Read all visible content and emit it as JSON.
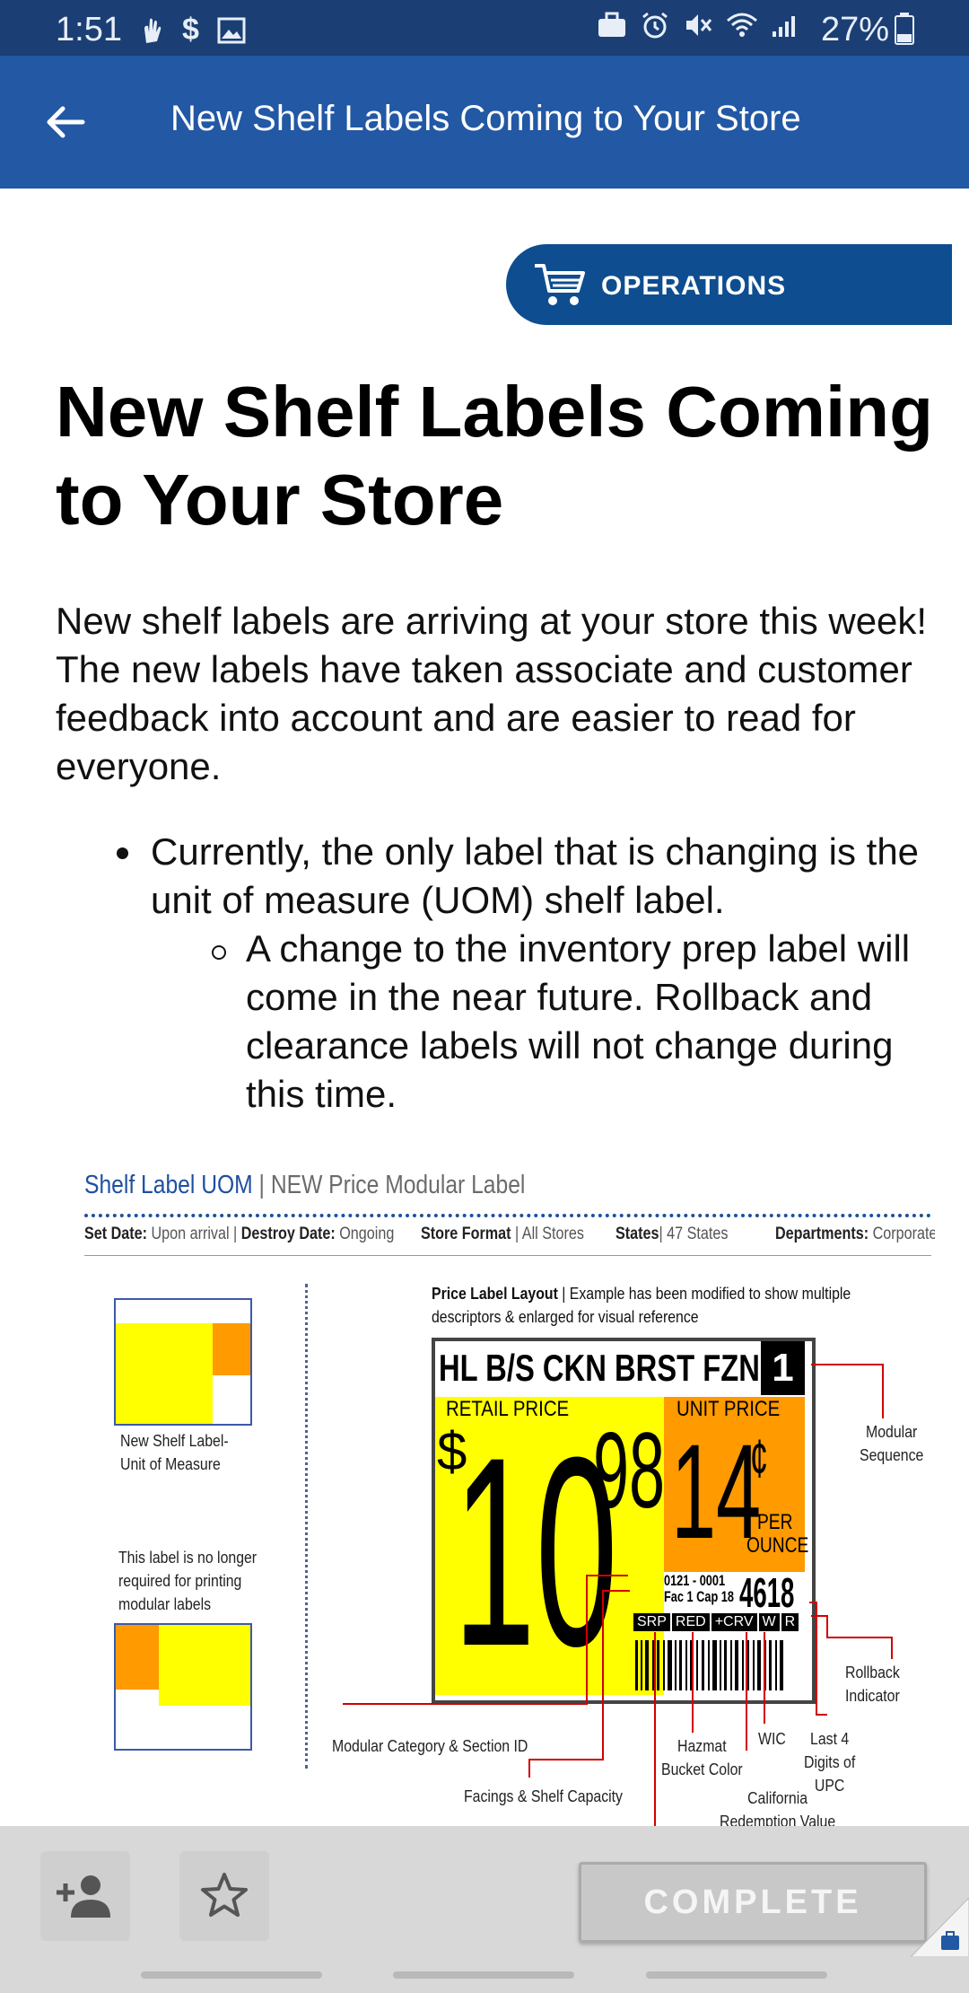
{
  "status_bar": {
    "time": "1:51",
    "battery": "27%"
  },
  "app_bar": {
    "title": "New Shelf Labels Coming to Your Store"
  },
  "badge": {
    "label": "OPERATIONS"
  },
  "article": {
    "title": "New Shelf Labels Coming to Your Store",
    "intro": "New shelf labels are arriving at your store this week! The new labels have taken associate and customer feedback into account and are easier to read for everyone.",
    "bullet1": "Currently, the only label that is changing is the unit of measure (UOM) shelf label.",
    "sub_bullet": "A change to the inventory prep label will come in the near future. Rollback and clearance labels will not change during this time."
  },
  "figure": {
    "heading": "Shelf Label UOM",
    "heading_sep": "|",
    "subheading": "NEW Price Modular Label",
    "meta": {
      "set_date_label": "Set Date:",
      "set_date": "Upon arrival",
      "destroy_date_label": "Destroy Date:",
      "destroy_date": "Ongoing",
      "store_format_label": "Store Format",
      "store_format": "All Stores",
      "states_label": "States",
      "states": "47 States",
      "departments_label": "Departments:",
      "departments": "Corporate"
    },
    "thumb1_caption_1": "New Shelf Label-",
    "thumb1_caption_2": "Unit of Measure",
    "thumb2_caption_1": "This label is no longer",
    "thumb2_caption_2": "required for printing",
    "thumb2_caption_3": "modular labels",
    "layout_title": "Price Label Layout",
    "layout_note_1": "Example has been modified to show multiple",
    "layout_note_2": "descriptors &  enlarged for visual reference",
    "label": {
      "description": "HL B/S CKN BRST FZN",
      "sequence": "1",
      "retail_price_label": "RETAIL PRICE",
      "dollar_sign": "$",
      "dollars": "10",
      "cents": "98",
      "unit_price_label": "UNIT PRICE",
      "unit_price": "14",
      "cent_sign": "¢",
      "per": "PER",
      "ounce": "OUNCE",
      "modular_id": "0121 - 0001",
      "facings": "Fac 1 Cap 18",
      "upc_last4": "4618",
      "codes": [
        "SRP",
        "RED",
        "+CRV",
        "W",
        "R"
      ]
    },
    "callouts": {
      "modular_sequence_1": "Modular",
      "modular_sequence_2": "Sequence",
      "rollback": "Rollback Indicator",
      "modular_category": "Modular Category & Section ID",
      "hazmat_1": "Hazmat",
      "hazmat_2": "Bucket Color",
      "wic": "WIC",
      "last4_1": "Last 4",
      "last4_2": "Digits of",
      "last4_3": "UPC",
      "facings": "Facings & Shelf Capacity",
      "california_1": "California",
      "california_2": "Redemption Value"
    }
  },
  "bottom_bar": {
    "complete_label": "COMPLETE"
  },
  "colors": {
    "status_bar": "#1b3f74",
    "app_bar": "#2258a4",
    "badge": "#0e4d8f",
    "yellow": "#ffff00",
    "orange": "#ff9a00",
    "callout": "#d10000"
  }
}
